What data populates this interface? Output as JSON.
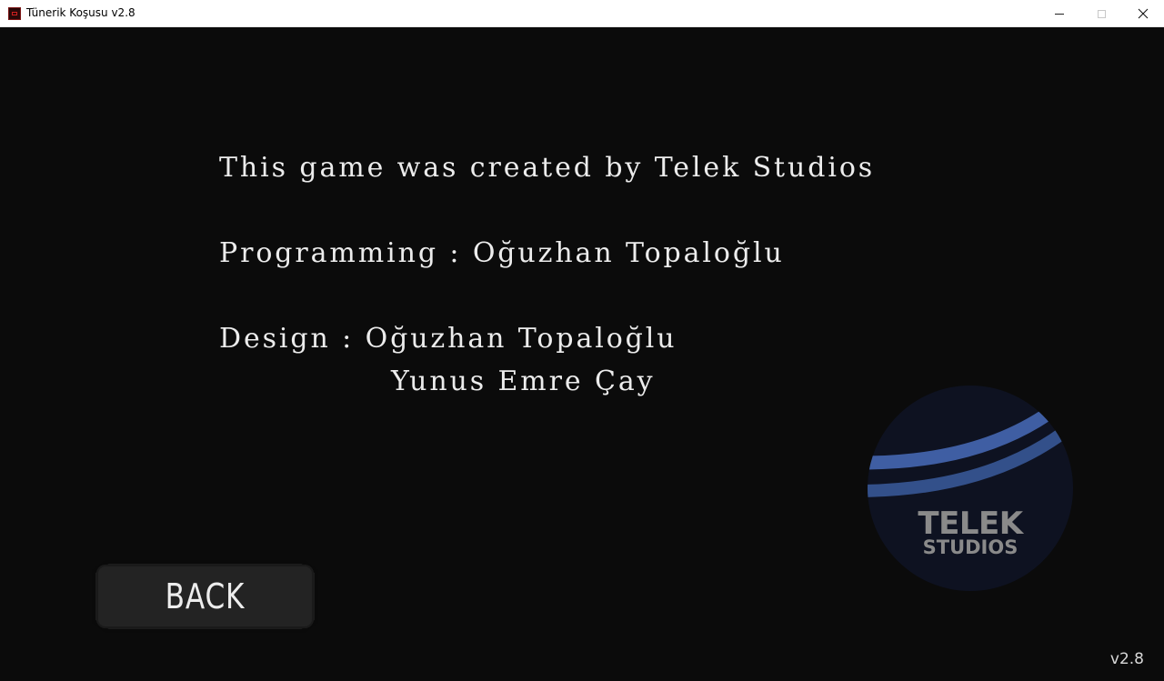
{
  "window": {
    "title": "Tünerik Koşusu v2.8",
    "controls": {
      "minimize": "—",
      "maximize": "☐",
      "close": "✕"
    }
  },
  "credits": {
    "line1": "This game was created by Telek Studios",
    "line2": "Programming : Oğuzhan Topaloğlu",
    "line3": "Design : Oğuzhan Topaloğlu",
    "line4": "Yunus Emre Çay"
  },
  "back_button": {
    "label": "BACK"
  },
  "logo": {
    "line1": "TELEK",
    "line2": "STUDIOS",
    "colors": {
      "circle": "#0e1221",
      "stripe_light": "#3f5ea3",
      "stripe_dark": "#2f4f8f",
      "text": "#8a8a8a"
    }
  },
  "version": "v2.8"
}
